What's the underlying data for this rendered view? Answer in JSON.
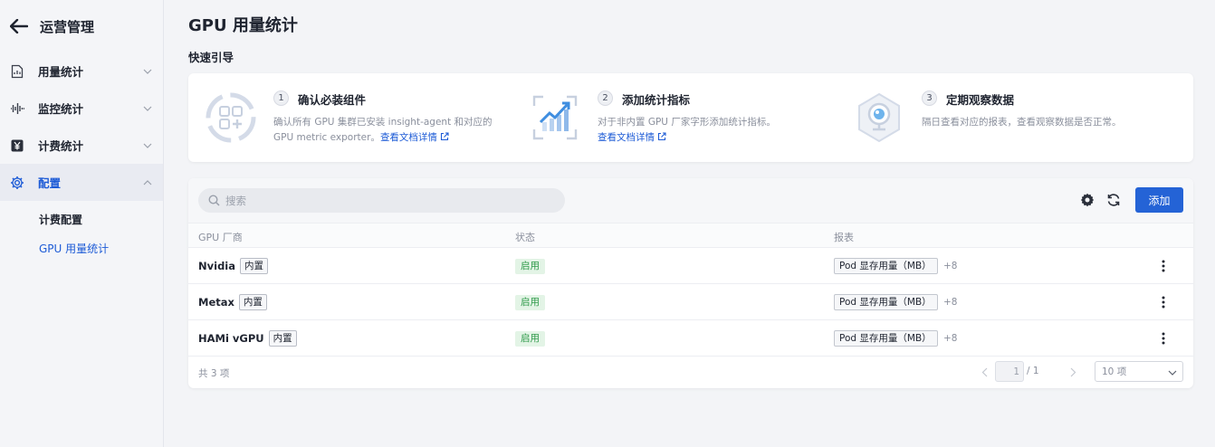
{
  "sidebar": {
    "title": "运营管理",
    "items": [
      {
        "label": "用量统计",
        "icon": "document-chart-icon"
      },
      {
        "label": "监控统计",
        "icon": "waveform-icon"
      },
      {
        "label": "计费统计",
        "icon": "yen-icon"
      },
      {
        "label": "配置",
        "icon": "gear-icon",
        "expanded": true
      }
    ],
    "sub_items": [
      {
        "label": "计费配置"
      },
      {
        "label": "GPU 用量统计",
        "active": true
      }
    ]
  },
  "page": {
    "title": "GPU 用量统计",
    "guide_title": "快速引导"
  },
  "guide": {
    "steps": [
      {
        "num": "1",
        "title": "确认必装组件",
        "desc_line1": "确认所有 GPU 集群已安装 insight-agent 和对应的",
        "desc_line2": "GPU metric exporter。",
        "link": "查看文档详情"
      },
      {
        "num": "2",
        "title": "添加统计指标",
        "desc_line1": "对于非内置 GPU 厂家字形添加统计指标。",
        "link": "查看文档详情"
      },
      {
        "num": "3",
        "title": "定期观察数据",
        "desc_line1": "隔日查看对应的报表，查看观察数据是否正常。"
      }
    ]
  },
  "toolbar": {
    "search_placeholder": "搜索",
    "add_label": "添加"
  },
  "table": {
    "columns": [
      "GPU 厂商",
      "状态",
      "报表"
    ],
    "rows": [
      {
        "vendor": "Nvidia",
        "tag": "内置",
        "status": "启用",
        "report": "Pod 显存用量（MB）",
        "more": "+8"
      },
      {
        "vendor": "Metax",
        "tag": "内置",
        "status": "启用",
        "report": "Pod 显存用量（MB）",
        "more": "+8"
      },
      {
        "vendor": "HAMi vGPU",
        "tag": "内置",
        "status": "启用",
        "report": "Pod 显存用量（MB）",
        "more": "+8"
      }
    ]
  },
  "pagination": {
    "total_text": "共 3 项",
    "current_page": "1",
    "total_pages": "/ 1",
    "page_size": "10 项"
  },
  "colors": {
    "primary": "#2463d6",
    "status_green": "#2f9a4a",
    "status_bg": "#e3f4e6"
  }
}
